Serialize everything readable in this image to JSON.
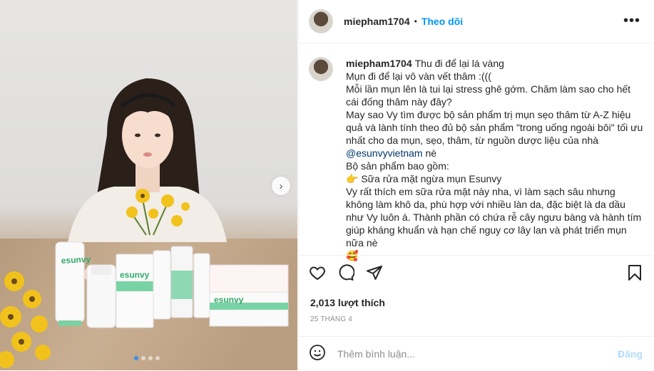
{
  "post": {
    "username": "miepham1704",
    "follow_label": "Theo dõi",
    "header_separator": "•",
    "more_label": "•••"
  },
  "caption": {
    "username": "miepham1704",
    "first_line": "Thu đi để lại lá vàng",
    "lines": [
      "Mụn đi để lại vô vàn vết thâm :(((",
      "Mỗi lần mụn lên là tui lại stress ghê gớm. Chăm làm sao cho hết cái đống thâm này đây?",
      "May sao Vy tìm được bộ sản phẩm trị mụn sẹo thâm từ A-Z hiệu quả và lành tính theo đủ bộ sản phẩm \"trong uống ngoài bôi\" tối ưu nhất cho da mụn, sẹo, thâm, từ nguồn dược liệu của nhà"
    ],
    "mention": "@esunvyvietnam",
    "mention_suffix": " nè",
    "products_heading": "Bộ sản phẩm bao gồm:",
    "product_item": "👉 Sữa rửa mặt ngừa mụn Esunvy",
    "review": "Vy rất thích em sữa rửa mặt này nha, vì làm sạch sâu nhưng không làm khô da, phù hợp với nhiều làn da, đặc biệt là da dầu như Vy luôn á. Thành phần có chứa rễ cây ngưu bàng và hành tím giúp kháng khuẩn và hạn chế nguy cơ lây lan và phát triển mụn nữa nè",
    "emoji": "🥰"
  },
  "stats": {
    "likes": "2,013 lượt thích",
    "date": "25 THÁNG 4"
  },
  "comment": {
    "placeholder": "Thêm bình luận...",
    "post_label": "Đăng"
  },
  "photo": {
    "brand_text": "esunvy",
    "carousel_count": 4,
    "active_index": 0
  }
}
